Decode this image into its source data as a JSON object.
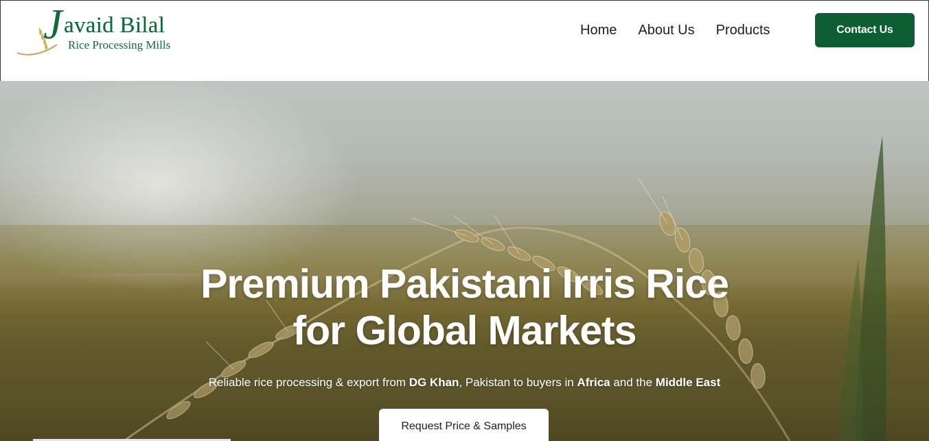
{
  "brand": {
    "logo_letter": "J",
    "logo_title": "avaid Bilal",
    "logo_subtitle": "Rice Processing Mills",
    "color": "#0f6b3b"
  },
  "nav": {
    "items": [
      {
        "label": "Home"
      },
      {
        "label": "About Us"
      },
      {
        "label": "Products"
      }
    ],
    "contact_label": "Contact Us",
    "contact_color": "#0d5e33"
  },
  "hero": {
    "title_line1": "Premium Pakistani Irris Rice",
    "title_line2": "for Global Markets",
    "subtitle": {
      "part1": "Reliable rice processing & export from ",
      "bold1": "DG Khan",
      "part2": ", Pakistan to buyers in ",
      "bold2": "Africa",
      "part3": " and the ",
      "bold3": "Middle East"
    },
    "cta_label": "Request Price & Samples"
  }
}
